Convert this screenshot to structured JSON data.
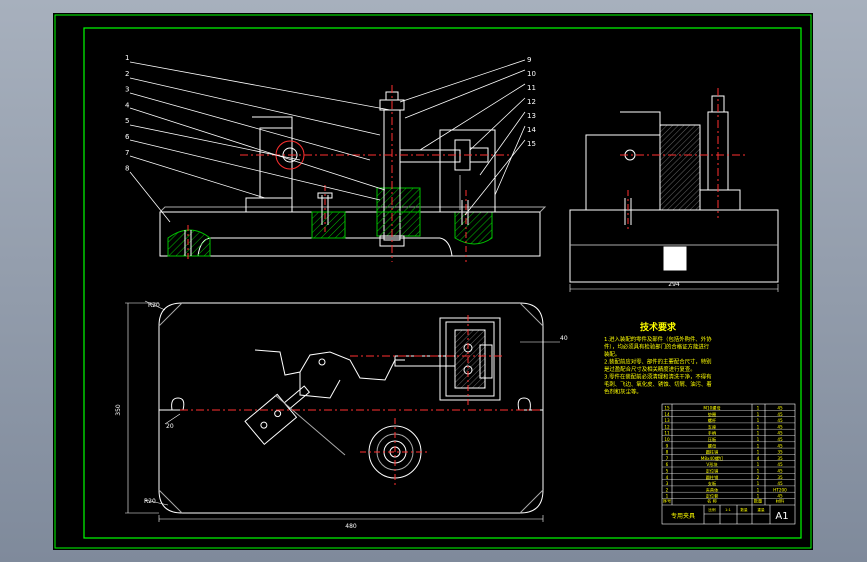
{
  "colors": {
    "desk": "#8e98a8",
    "paper": "#000000",
    "frame": "#00ff00",
    "lines": "#ffffff",
    "hatch": "#00c000",
    "center": "#ff3030",
    "dim": "#ffffff",
    "text": "#ffff00",
    "magenta": "#ff00ff"
  },
  "drawing": {
    "title": "专用夹具",
    "sheet_size": "A1",
    "tech_title": "技术要求",
    "tech_lines": [
      "1.进入装配的零件及部件（包括外购件、外协",
      "件），均必须具有检验部门的合格证方能进行",
      "装配。",
      "2.装配前应对零、部件的主要配合尺寸，特别",
      "是过盈配合尺寸及相关精度进行复查。",
      "3.零件在装配前必须清理和清洗干净，不得有",
      "毛刺、飞边、氧化皮、锈蚀、切屑、油污、着",
      "色剂和灰尘等。"
    ],
    "balloons_left": [
      "1",
      "2",
      "3",
      "4",
      "5",
      "6",
      "7",
      "8"
    ],
    "balloons_right": [
      "9",
      "10",
      "11",
      "12",
      "13",
      "14",
      "15"
    ],
    "dims": {
      "plan_height": "350",
      "plan_length": "480",
      "plan_hole": "20",
      "plan_top": "R20",
      "plan_bot": "R20",
      "side_width": "294",
      "plan_right": "40"
    },
    "bom_rows": [
      [
        "15",
        "M10螺母",
        "1",
        "45"
      ],
      [
        "14",
        "垫圈",
        "1",
        "45"
      ],
      [
        "13",
        "螺杆",
        "1",
        "45"
      ],
      [
        "12",
        "支座",
        "1",
        "45"
      ],
      [
        "11",
        "手柄",
        "1",
        "45"
      ],
      [
        "10",
        "压板",
        "1",
        "45"
      ],
      [
        "9",
        "螺母",
        "1",
        "45"
      ],
      [
        "8",
        "圆柱销",
        "1",
        "35"
      ],
      [
        "7",
        "M8x40螺钉",
        "4",
        "35"
      ],
      [
        "6",
        "V形块",
        "1",
        "45"
      ],
      [
        "5",
        "定位销",
        "1",
        "45"
      ],
      [
        "4",
        "圆柱销",
        "2",
        "35"
      ],
      [
        "3",
        "支板",
        "1",
        "45"
      ],
      [
        "2",
        "夹具体",
        "1",
        "HT200"
      ],
      [
        "1",
        "定位套",
        "1",
        "45"
      ]
    ],
    "bom_header": [
      "序号",
      "名 称",
      "数量",
      "材料"
    ],
    "title_small": [
      "比例",
      "1:1",
      "数量",
      "重量"
    ]
  }
}
